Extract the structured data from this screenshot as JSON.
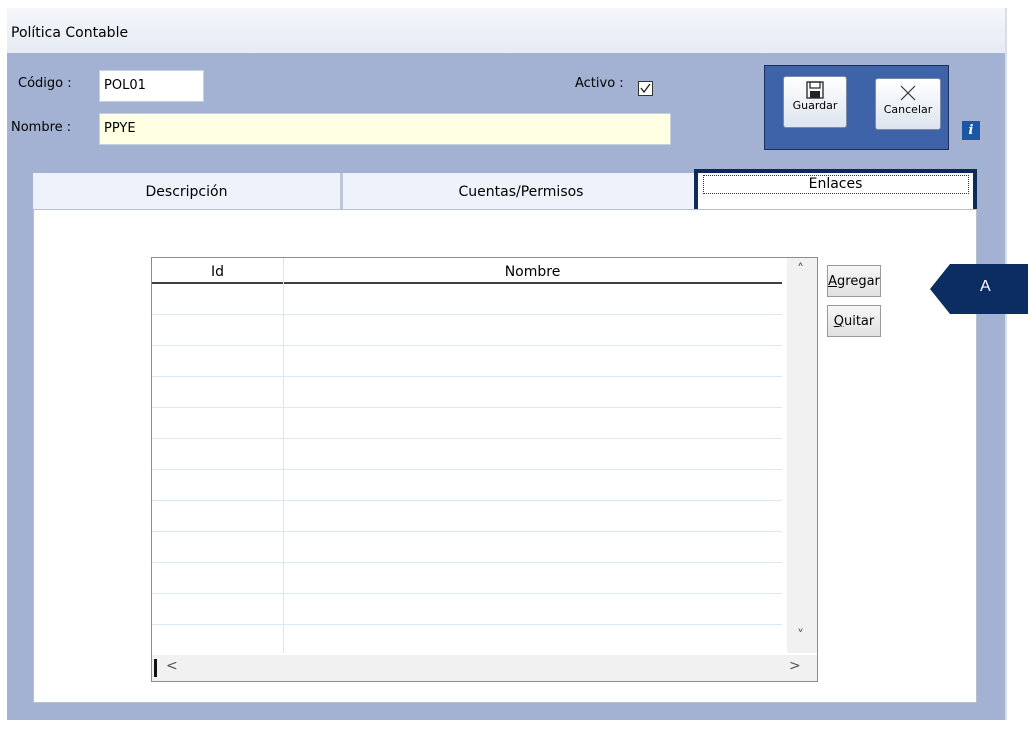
{
  "window": {
    "title": "Política Contable"
  },
  "form": {
    "codigo_label": "Código :",
    "codigo_value": "POL01",
    "nombre_label": "Nombre :",
    "nombre_value": "PPYE",
    "activo_label": "Activo :",
    "activo_checked": true
  },
  "toolbar": {
    "save_label": "Guardar",
    "cancel_label": "Cancelar",
    "info_icon": "i"
  },
  "tabs": [
    {
      "label": "Descripción",
      "active": false
    },
    {
      "label": "Cuentas/Permisos",
      "active": false
    },
    {
      "label": "Enlaces",
      "active": true
    }
  ],
  "grid": {
    "columns": [
      "Id",
      "Nombre"
    ],
    "rows": []
  },
  "actions": {
    "add_label": "Agregar",
    "remove_label": "Quitar"
  },
  "callout": {
    "label": "A",
    "color": "#0c2d62"
  },
  "colors": {
    "window_bg": "#a3b2d2",
    "button_panel": "#3e63a8",
    "active_tab_border": "#0c2a5a"
  }
}
